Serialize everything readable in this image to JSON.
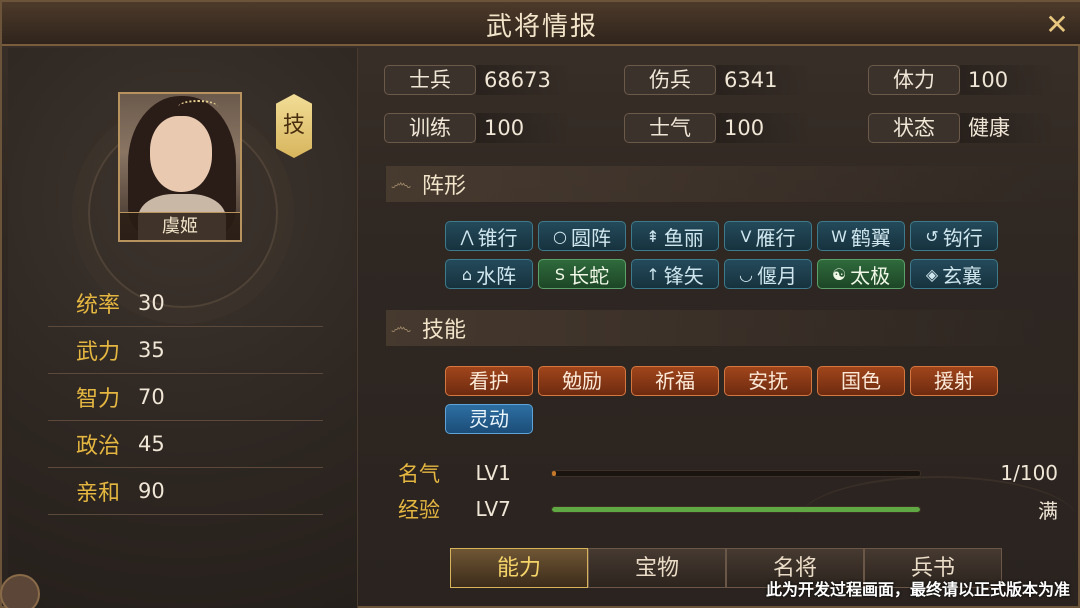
{
  "window": {
    "title": "武将情报",
    "close_icon": "✕"
  },
  "general": {
    "name": "虞姬",
    "skill_tag": "技"
  },
  "attributes": [
    {
      "label": "统率",
      "value": "30"
    },
    {
      "label": "武力",
      "value": "35"
    },
    {
      "label": "智力",
      "value": "70"
    },
    {
      "label": "政治",
      "value": "45"
    },
    {
      "label": "亲和",
      "value": "90"
    }
  ],
  "stats": [
    {
      "label": "士兵",
      "value": "68673"
    },
    {
      "label": "伤兵",
      "value": "6341"
    },
    {
      "label": "体力",
      "value": "100"
    },
    {
      "label": "训练",
      "value": "100"
    },
    {
      "label": "士气",
      "value": "100"
    },
    {
      "label": "状态",
      "value": "健康"
    }
  ],
  "formation_section": {
    "title": "阵形"
  },
  "formations": [
    {
      "label": "锥行",
      "glyph": "⋀",
      "icon": "arrowhead-icon",
      "style": "blue"
    },
    {
      "label": "圆阵",
      "glyph": "○",
      "icon": "circle-icon",
      "style": "blue"
    },
    {
      "label": "鱼丽",
      "glyph": "⇞",
      "icon": "fish-icon",
      "style": "blue"
    },
    {
      "label": "雁行",
      "glyph": "V",
      "icon": "v-icon",
      "style": "blue"
    },
    {
      "label": "鹤翼",
      "glyph": "W",
      "icon": "wing-icon",
      "style": "blue"
    },
    {
      "label": "钩行",
      "glyph": "↺",
      "icon": "hook-icon",
      "style": "blue"
    },
    {
      "label": "水阵",
      "glyph": "⌂",
      "icon": "water-icon",
      "style": "blue"
    },
    {
      "label": "长蛇",
      "glyph": "S",
      "icon": "snake-icon",
      "style": "green"
    },
    {
      "label": "锋矢",
      "glyph": "↑",
      "icon": "arrow-up-icon",
      "style": "blue"
    },
    {
      "label": "偃月",
      "glyph": "◡",
      "icon": "crescent-icon",
      "style": "blue"
    },
    {
      "label": "太极",
      "glyph": "☯",
      "icon": "taiji-icon",
      "style": "green"
    },
    {
      "label": "玄襄",
      "glyph": "◈",
      "icon": "diamond-icon",
      "style": "blue"
    }
  ],
  "skill_section": {
    "title": "技能"
  },
  "skills": [
    {
      "label": "看护",
      "style": "orange"
    },
    {
      "label": "勉励",
      "style": "orange"
    },
    {
      "label": "祈福",
      "style": "orange"
    },
    {
      "label": "安抚",
      "style": "orange"
    },
    {
      "label": "国色",
      "style": "orange"
    },
    {
      "label": "援射",
      "style": "orange"
    },
    {
      "label": "灵动",
      "style": "sblue"
    }
  ],
  "progress": [
    {
      "label": "名气",
      "level": "LV1",
      "right": "1/100",
      "fraction": 0.01,
      "color": "#c7792a"
    },
    {
      "label": "经验",
      "level": "LV7",
      "right": "满",
      "fraction": 1.0,
      "color": "#5fa843"
    }
  ],
  "tabs": [
    {
      "label": "能力",
      "active": true
    },
    {
      "label": "宝物",
      "active": false
    },
    {
      "label": "名将",
      "active": false
    },
    {
      "label": "兵书",
      "active": false
    }
  ],
  "notice": "此为开发过程画面，最终请以正式版本为准"
}
